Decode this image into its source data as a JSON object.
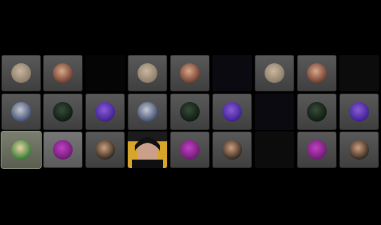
{
  "tiles": [
    {
      "avatar": "person-holding-object-avatar",
      "style": "filled",
      "colors": [
        "#8a7a66",
        "#c9b7a0"
      ]
    },
    {
      "avatar": "woman-long-hair-avatar",
      "style": "filled",
      "colors": [
        "#6b3a2c",
        "#d9a88a"
      ]
    },
    {
      "avatar": null,
      "style": "empty"
    },
    {
      "avatar": "person-holding-object-avatar",
      "style": "filled",
      "colors": [
        "#8a7a66",
        "#c9b7a0"
      ]
    },
    {
      "avatar": "woman-long-hair-avatar",
      "style": "filled",
      "colors": [
        "#6b3a2c",
        "#d9a88a"
      ]
    },
    {
      "avatar": null,
      "style": "dim"
    },
    {
      "avatar": "person-holding-object-avatar",
      "style": "filled",
      "colors": [
        "#8a7a66",
        "#c9b7a0"
      ]
    },
    {
      "avatar": "woman-long-hair-avatar",
      "style": "filled",
      "colors": [
        "#6b3a2c",
        "#d9a88a"
      ]
    },
    {
      "avatar": null,
      "style": "dimmer"
    },
    {
      "avatar": "robot-avatar",
      "style": "filled",
      "colors": [
        "#3c4b6e",
        "#c7c9d2"
      ]
    },
    {
      "avatar": "dark-figure-avatar",
      "style": "filled",
      "colors": [
        "#0a1a10",
        "#3a4a3a"
      ]
    },
    {
      "avatar": "purple-light-avatar",
      "style": "filled",
      "colors": [
        "#3a1f8c",
        "#8a5ad9"
      ]
    },
    {
      "avatar": "robot-avatar",
      "style": "filled",
      "colors": [
        "#3c4b6e",
        "#c7c9d2"
      ]
    },
    {
      "avatar": "dark-figure-avatar",
      "style": "filled",
      "colors": [
        "#0a1a10",
        "#3a4a3a"
      ]
    },
    {
      "avatar": "purple-light-avatar",
      "style": "filled",
      "colors": [
        "#3a1f8c",
        "#8a5ad9"
      ]
    },
    {
      "avatar": null,
      "style": "dim"
    },
    {
      "avatar": "dark-figure-avatar",
      "style": "filled",
      "colors": [
        "#0a1a10",
        "#3a4a3a"
      ]
    },
    {
      "avatar": "purple-light-avatar",
      "style": "filled",
      "colors": [
        "#3a1f8c",
        "#8a5ad9"
      ]
    },
    {
      "avatar": "green-character-avatar",
      "style": "hl",
      "colors": [
        "#2d7a2f",
        "#e8d2a6"
      ]
    },
    {
      "avatar": "magenta-figure-avatar",
      "style": "filled",
      "colors": [
        "#6a1a6e",
        "#c041c4"
      ]
    },
    {
      "avatar": "young-man-avatar",
      "style": "filled",
      "colors": [
        "#2b2319",
        "#cf9f80"
      ]
    },
    {
      "avatar": "webcam-video-feed",
      "style": "cam",
      "colors": [
        "#d7a52a",
        "#3a2a20"
      ]
    },
    {
      "avatar": "magenta-figure-avatar",
      "style": "filled",
      "colors": [
        "#6a1a6e",
        "#c041c4"
      ]
    },
    {
      "avatar": "young-man-avatar",
      "style": "filled",
      "colors": [
        "#2b2319",
        "#cf9f80"
      ]
    },
    {
      "avatar": null,
      "style": "dimmer"
    },
    {
      "avatar": "magenta-figure-avatar",
      "style": "filled",
      "colors": [
        "#6a1a6e",
        "#c041c4"
      ]
    },
    {
      "avatar": "young-man-avatar",
      "style": "filled",
      "colors": [
        "#2b2319",
        "#cf9f80"
      ]
    }
  ]
}
